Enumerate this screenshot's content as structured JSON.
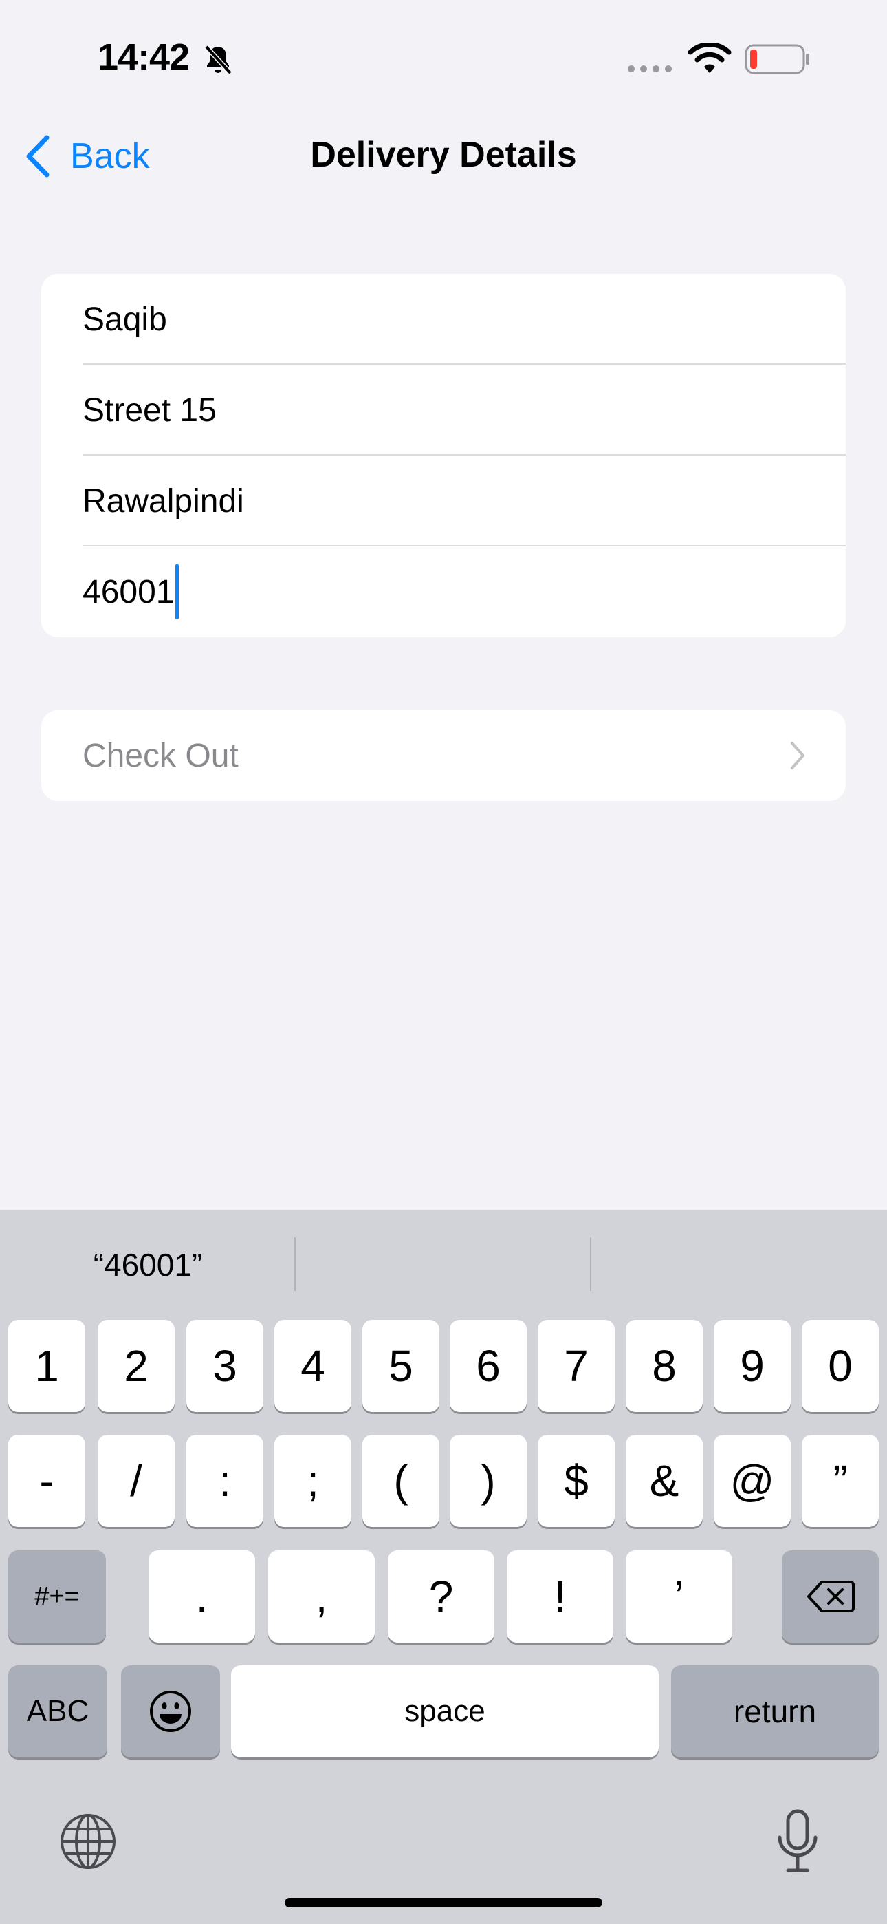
{
  "status": {
    "time": "14:42",
    "battery_color": "#ff3b30"
  },
  "nav": {
    "back_label": "Back",
    "title": "Delivery Details"
  },
  "form": {
    "name": "Saqib",
    "street": "Street 15",
    "city": "Rawalpindi",
    "postal": "46001"
  },
  "checkout": {
    "label": "Check Out"
  },
  "keyboard": {
    "suggestion": "“46001”",
    "row1": [
      "1",
      "2",
      "3",
      "4",
      "5",
      "6",
      "7",
      "8",
      "9",
      "0"
    ],
    "row2": [
      "-",
      "/",
      ":",
      ";",
      "(",
      ")",
      "$",
      "&",
      "@",
      "”"
    ],
    "row3": {
      "symbols": "#+=",
      "keys": [
        ".",
        ",",
        "?",
        "!",
        "’"
      ]
    },
    "abc": "ABC",
    "space": "space",
    "return": "return"
  },
  "colors": {
    "accent": "#0a84ff",
    "background": "#f2f2f7",
    "keyboard_bg": "#d1d3d9"
  }
}
